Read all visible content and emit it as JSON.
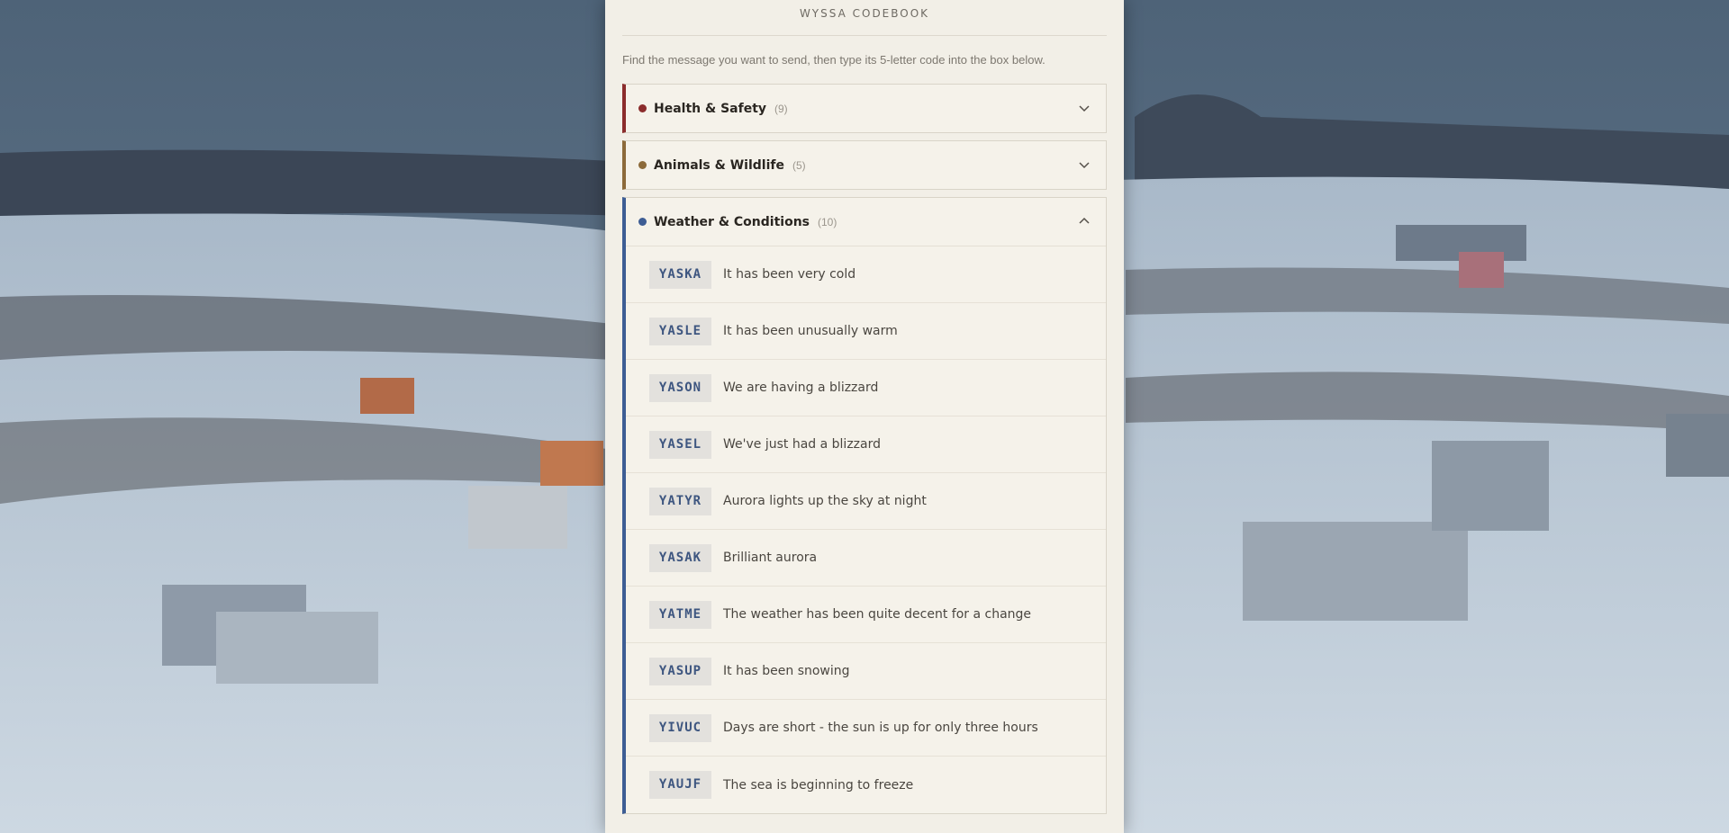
{
  "header": {
    "title": "WYSSA CODEBOOK"
  },
  "instructions": "Find the message you want to send, then type its 5-letter code into the box below.",
  "colors": {
    "health": "#8b2c2c",
    "animals": "#8c6a3a",
    "weather": "#3d5d94"
  },
  "categories": [
    {
      "name": "Health & Safety",
      "count": "(9)",
      "expanded": false,
      "icon": "chevron-down-icon"
    },
    {
      "name": "Animals & Wildlife",
      "count": "(5)",
      "expanded": false,
      "icon": "chevron-down-icon"
    },
    {
      "name": "Weather & Conditions",
      "count": "(10)",
      "expanded": true,
      "icon": "chevron-up-icon",
      "items": [
        {
          "code": "YASKA",
          "text": "It has been very cold"
        },
        {
          "code": "YASLE",
          "text": "It has been unusually warm"
        },
        {
          "code": "YASON",
          "text": "We are having a blizzard"
        },
        {
          "code": "YASEL",
          "text": "We've just had a blizzard"
        },
        {
          "code": "YATYR",
          "text": "Aurora lights up the sky at night"
        },
        {
          "code": "YASAK",
          "text": "Brilliant aurora"
        },
        {
          "code": "YATME",
          "text": "The weather has been quite decent for a change"
        },
        {
          "code": "YASUP",
          "text": "It has been snowing"
        },
        {
          "code": "YIVUC",
          "text": "Days are short - the sun is up for only three hours"
        },
        {
          "code": "YAUJF",
          "text": "The sea is beginning to freeze"
        }
      ]
    }
  ]
}
